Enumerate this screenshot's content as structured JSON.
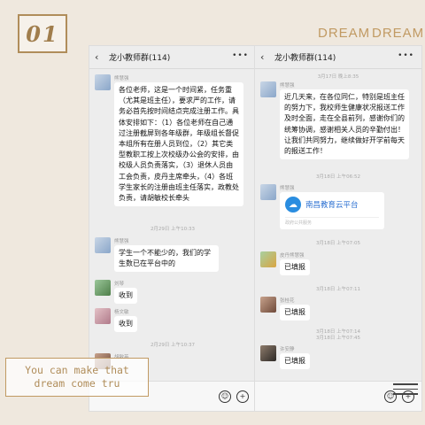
{
  "badge": "01",
  "dreams": [
    "DREAM",
    "DREAM"
  ],
  "slogan": [
    "You can make that",
    "dream come tru"
  ],
  "left_phone": {
    "title": "龙小教师群(114)",
    "message1": {
      "sender": "熊慧强",
      "text": "各位老师，这是一个时间紧，任务重（尤其是班主任），要求严的工作，请务必首先按时间结点完成注册工作。具体安排如下：（1）各位老师在自己通过注册截屏到各年级群，年级组长督促本组所有在册人员到位，（2）其它类型教职工按上次校级办公会的安排，由校级人员负责落实，（3）退休人员由工会负责，皮丹主席牵头，（4）各班学生家长的注册由班主任落实，政教处负责，请胡敏校长牵头"
    },
    "time1": "2月29日 上午10:33",
    "message2": {
      "sender": "熊慧强",
      "text": "学生一个不能少的，我们的学生数已在平台中的"
    },
    "message3": {
      "sender": "刘琴",
      "text": "收到"
    },
    "message4": {
      "sender": "杨文敏",
      "text": "收到"
    },
    "time2": "2月29日 上午10:37",
    "message5": {
      "sender": "胡敏英"
    }
  },
  "right_phone": {
    "title": "龙小教师群(114)",
    "time0": "3月17日 晚上8:35",
    "message1": {
      "sender": "熊慧强",
      "text": "近几天来，在各位同仁，特别是班主任的努力下，我校师生健康状况报送工作及时全面，走在全县前列，感谢你们的统筹协调，感谢相关人员的辛勤付出！让我们共同努力，继续做好开学前每天的报送工作！"
    },
    "time1": "3月18日 上午06:52",
    "message2": {
      "sender": "熊慧强",
      "card_title": "南昌教育云平台",
      "card_sub": "政府公共服务"
    },
    "time2": "3月18日 上午07:05",
    "message3": {
      "sender": "皮丹熊慧强",
      "text": "已填报"
    },
    "time3": "3月18日 上午07:11",
    "message4": {
      "sender": "张桂花",
      "text": "已填报"
    },
    "time4": "3月18日 上午07:14",
    "time5": "3月18日 上午07:45",
    "message5": {
      "sender": "许安静",
      "text": "已填报"
    }
  }
}
